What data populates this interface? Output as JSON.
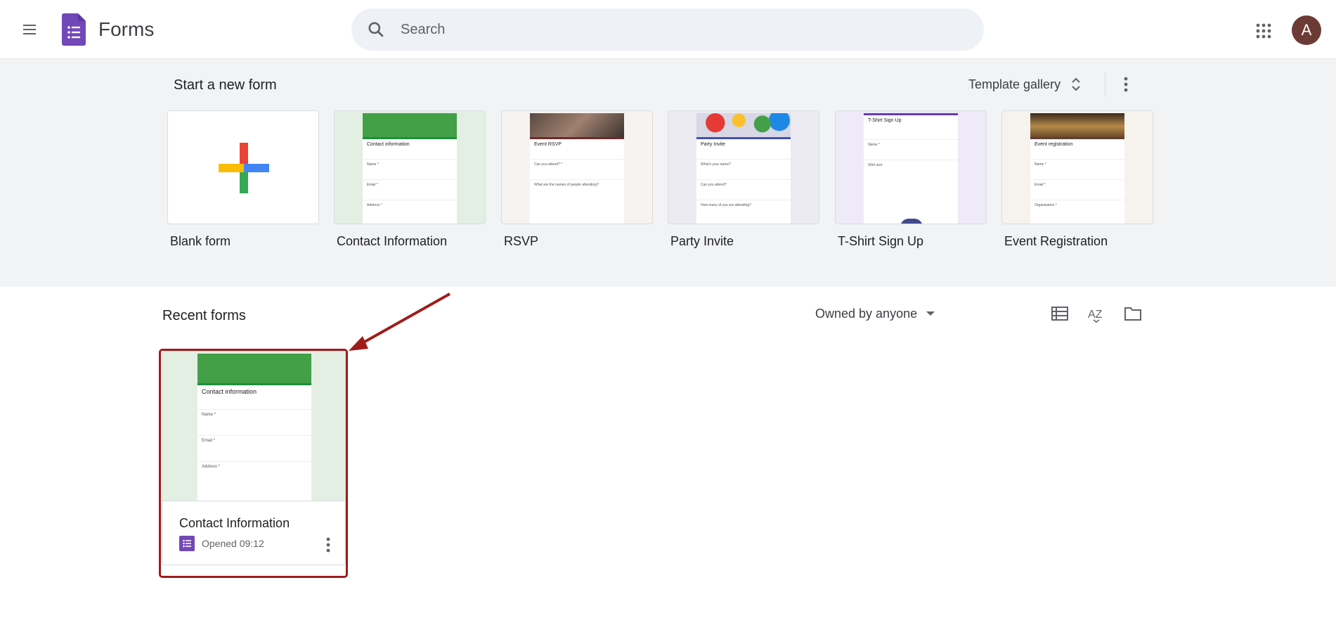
{
  "header": {
    "app_title": "Forms",
    "search_placeholder": "Search",
    "avatar_letter": "A"
  },
  "template_band": {
    "title": "Start a new form",
    "gallery_label": "Template gallery",
    "templates": [
      {
        "label": "Blank form"
      },
      {
        "label": "Contact Information",
        "mini_title": "Contact information",
        "mini_fields": [
          "Name *",
          "Email *",
          "Address *"
        ],
        "accent": "#1e8e3e"
      },
      {
        "label": "RSVP",
        "mini_title": "Event RSVP",
        "mini_fields": [
          "Can you attend? *",
          "What are the names of people attending?"
        ],
        "accent": "#6d2b2b"
      },
      {
        "label": "Party Invite",
        "mini_title": "Party Invite",
        "mini_fields": [
          "What's your name?",
          "Can you attend?",
          "How many of you are attending?"
        ],
        "accent": "#3f51b5"
      },
      {
        "label": "T-Shirt Sign Up",
        "mini_title": "T-Shirt Sign Up",
        "mini_fields": [
          "Name *",
          "Shirt size"
        ],
        "accent": "#673ab7"
      },
      {
        "label": "Event Registration",
        "mini_title": "Event registration",
        "mini_fields": [
          "Name *",
          "Email *",
          "Organization *"
        ],
        "accent": "#5d4037"
      }
    ]
  },
  "recent": {
    "title": "Recent forms",
    "owner_filter": "Owned by anyone",
    "items": [
      {
        "name": "Contact Information",
        "opened": "Opened 09:12",
        "mini_title": "Contact information",
        "mini_fields": [
          "Name *",
          "Email *",
          "Address *"
        ]
      }
    ]
  },
  "colors": {
    "forms_purple": "#7248b9",
    "highlight_red": "#a01b1b",
    "band_bg": "#f1f3f4",
    "contact_green": "#1e8e3e"
  }
}
